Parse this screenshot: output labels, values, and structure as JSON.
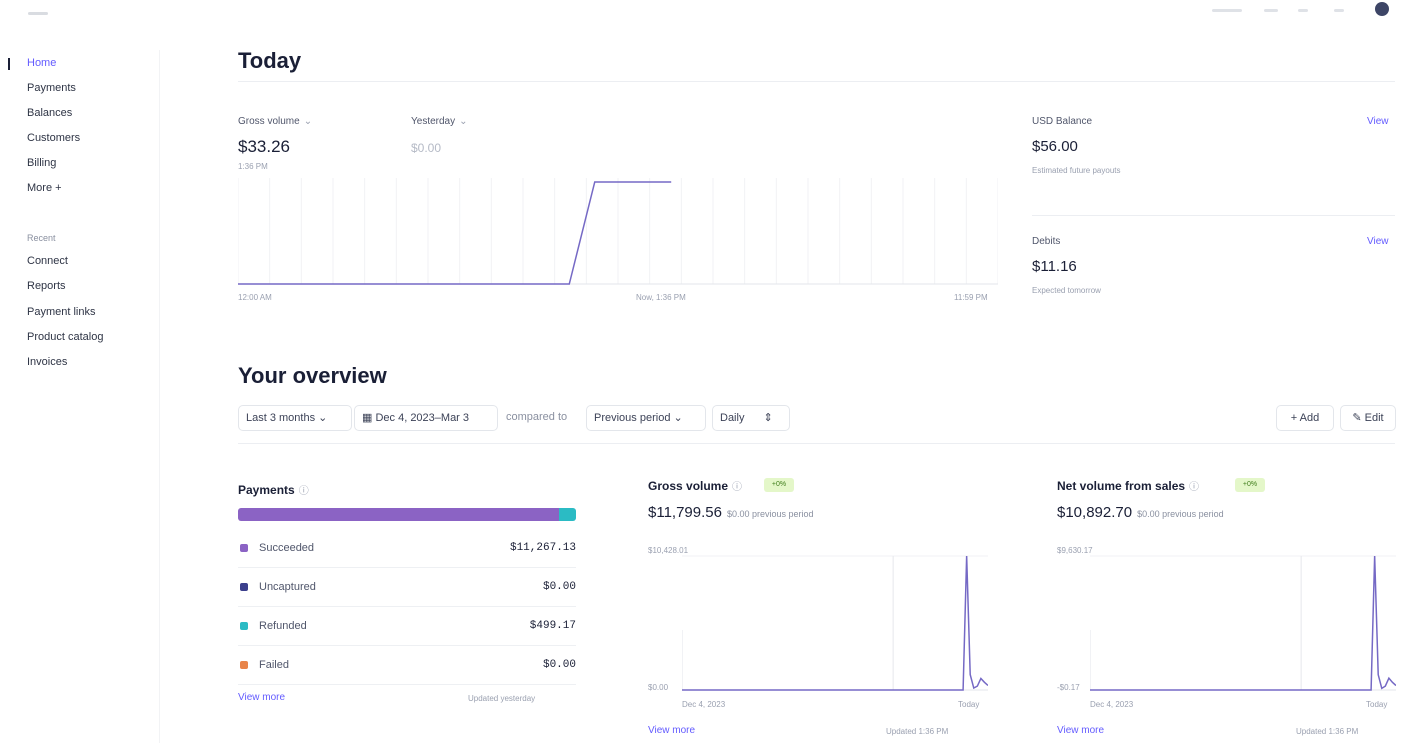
{
  "colors": {
    "accent": "#635bff",
    "line": "#7569c5",
    "succeeded": "#8b63c4",
    "uncaptured": "#3b3f8c",
    "refunded": "#2bbbc4",
    "failed": "#e8844a",
    "badge_bg": "#e4f7c9"
  },
  "sidebar": {
    "items": [
      {
        "label": "Home",
        "active": true
      },
      {
        "label": "Payments"
      },
      {
        "label": "Balances"
      },
      {
        "label": "Customers"
      },
      {
        "label": "Billing"
      },
      {
        "label": "More +"
      }
    ],
    "section_title": "Recent",
    "recent": [
      {
        "label": "Connect"
      },
      {
        "label": "Reports"
      },
      {
        "label": "Payment links"
      },
      {
        "label": "Product catalog"
      },
      {
        "label": "Invoices"
      }
    ]
  },
  "today": {
    "title": "Today",
    "gross_label": "Gross volume",
    "gross_value": "$33.26",
    "gross_time": "1:36 PM",
    "yesterday_label": "Yesterday",
    "yesterday_value": "$0.00",
    "axis_start": "12:00 AM",
    "axis_mid": "Now, 1:36 PM",
    "axis_end": "11:59 PM",
    "chart_series": [
      0,
      0,
      0,
      0,
      0,
      0,
      0,
      0,
      0,
      0,
      0,
      0,
      0,
      0,
      33.26,
      33.26,
      33.26,
      33.26
    ],
    "usd_balance_label": "USD Balance",
    "usd_balance_value": "$56.00",
    "usd_balance_sub": "Estimated future payouts",
    "usd_view": "View",
    "debits_label": "Debits",
    "debits_value": "$11.16",
    "debits_sub": "Expected tomorrow",
    "debits_view": "View"
  },
  "overview": {
    "title": "Your overview",
    "range": "Last 3 months",
    "dates": "Dec 4, 2023–Mar 3",
    "compared_to": "compared to",
    "comparison": "Previous period",
    "interval": "Daily",
    "add": "+ Add",
    "edit": "Edit"
  },
  "payments_card": {
    "title": "Payments",
    "rows": [
      {
        "name": "Succeeded",
        "amount": "$11,267.13"
      },
      {
        "name": "Uncaptured",
        "amount": "$0.00"
      },
      {
        "name": "Refunded",
        "amount": "$499.17"
      },
      {
        "name": "Failed",
        "amount": "$0.00"
      }
    ],
    "view_more": "View more",
    "updated": "Updated yesterday"
  },
  "gross_card": {
    "title": "Gross volume",
    "badge": "+0%",
    "value": "$11,799.56",
    "prev": "$0.00 previous period",
    "y_top": "$10,428.01",
    "y_bottom": "$0.00",
    "x_start": "Dec 4, 2023",
    "x_end": "Today",
    "view_more": "View more",
    "updated": "Updated 1:36 PM",
    "series": [
      0,
      0,
      0,
      0,
      0,
      0,
      0,
      0,
      0,
      0,
      0,
      0,
      0,
      0,
      0,
      0,
      0,
      0,
      0,
      0,
      0,
      0,
      0,
      0,
      0,
      0,
      0,
      0,
      0,
      0,
      0,
      0,
      0,
      0,
      0,
      0,
      0,
      0,
      0,
      0,
      0,
      0,
      0,
      0,
      0,
      0,
      0,
      0,
      0,
      0,
      0,
      0,
      0,
      0,
      0,
      0,
      0,
      0,
      0,
      0,
      0,
      0,
      0,
      0,
      0,
      0,
      0,
      0,
      0,
      0,
      0,
      0,
      0,
      0,
      0,
      0,
      0,
      0,
      0,
      0,
      10428.01,
      1200,
      150,
      300,
      900,
      600,
      350
    ]
  },
  "net_card": {
    "title": "Net volume from sales",
    "badge": "+0%",
    "value": "$10,892.70",
    "prev": "$0.00 previous period",
    "y_top": "$9,630.17",
    "y_bottom": "-$0.17",
    "x_start": "Dec 4, 2023",
    "x_end": "Today",
    "view_more": "View more",
    "updated": "Updated 1:36 PM",
    "series": [
      0,
      0,
      0,
      0,
      0,
      0,
      0,
      0,
      0,
      0,
      0,
      0,
      0,
      0,
      0,
      0,
      0,
      0,
      0,
      0,
      0,
      0,
      0,
      0,
      0,
      0,
      0,
      0,
      0,
      0,
      0,
      0,
      0,
      0,
      0,
      0,
      0,
      0,
      0,
      0,
      0,
      0,
      0,
      0,
      0,
      0,
      0,
      0,
      0,
      0,
      0,
      0,
      0,
      0,
      0,
      0,
      0,
      0,
      0,
      0,
      0,
      0,
      0,
      0,
      0,
      0,
      0,
      0,
      0,
      0,
      0,
      0,
      0,
      0,
      0,
      0,
      0,
      0,
      0,
      0,
      9630.17,
      1100,
      120,
      280,
      850,
      550,
      320
    ]
  }
}
